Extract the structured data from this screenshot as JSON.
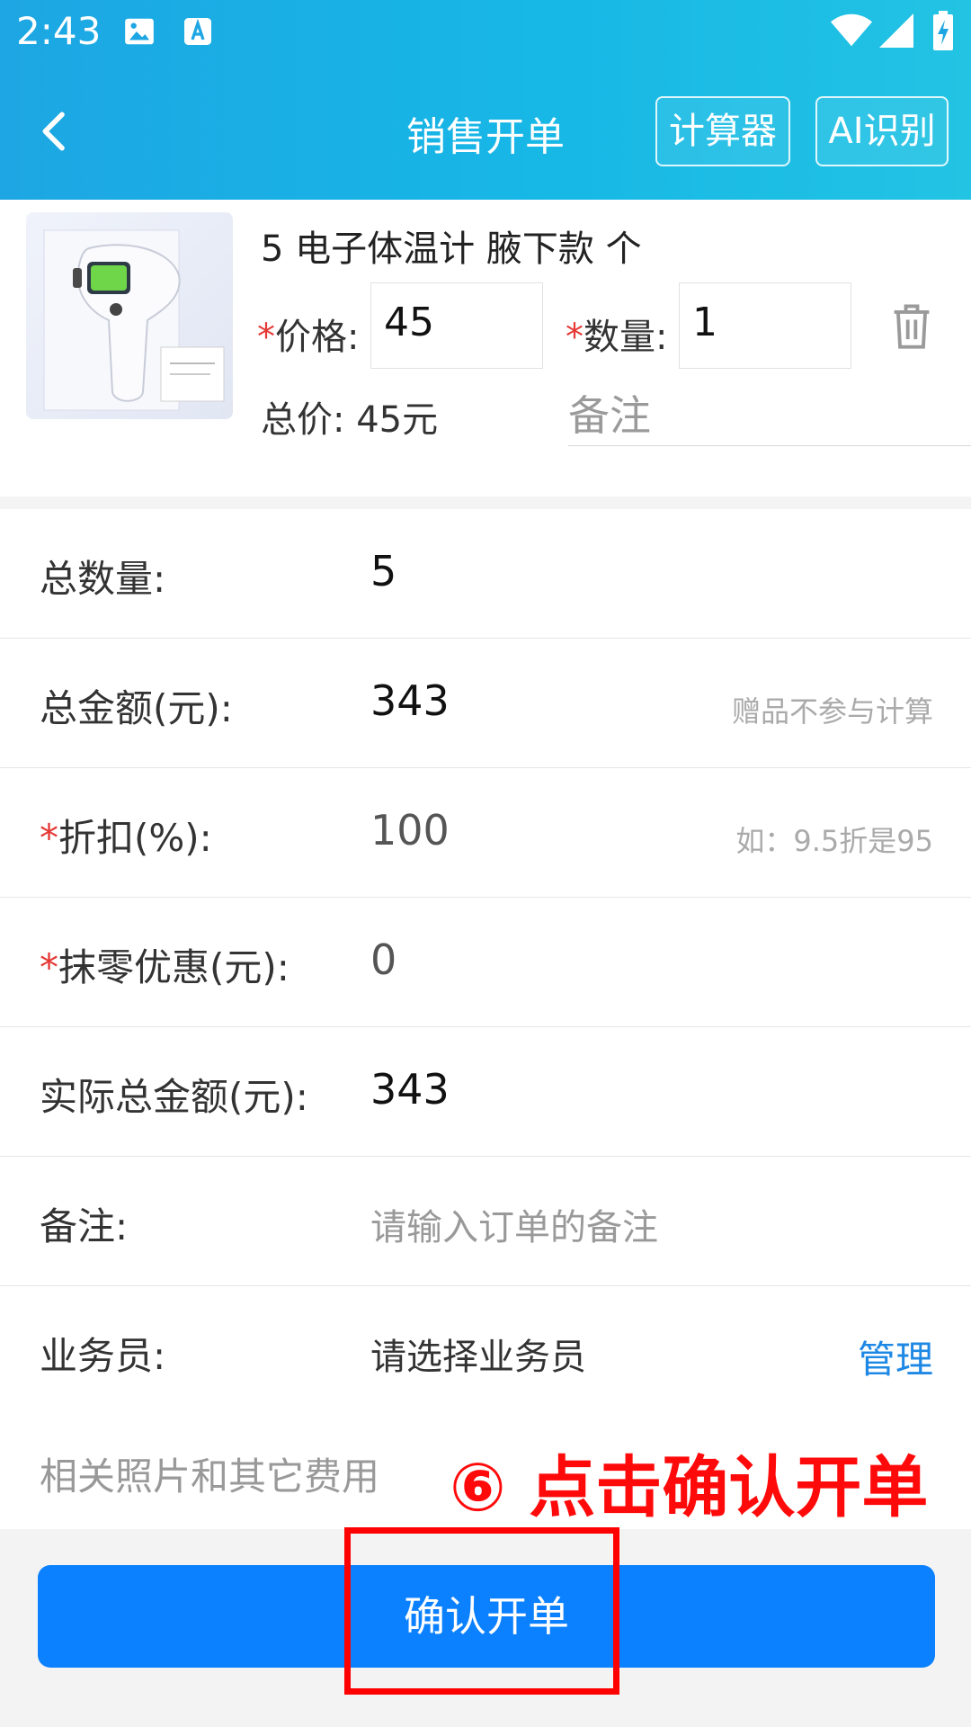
{
  "status_bar": {
    "time": "2:43"
  },
  "header": {
    "title": "销售开单",
    "calculator_label": "计算器",
    "ai_label": "AI识别"
  },
  "product": {
    "name": "5 电子体温计 腋下款 个",
    "price_label": "价格:",
    "price_value": "45",
    "qty_label": "数量:",
    "qty_value": "1",
    "total_label": "总价: 45元",
    "note_placeholder": "备注",
    "required_mark": "*"
  },
  "form": {
    "total_qty": {
      "label": "总数量:",
      "value": "5"
    },
    "total_amount": {
      "label": "总金额(元):",
      "value": "343",
      "hint": "赠品不参与计算"
    },
    "discount": {
      "label": "折扣(%):",
      "value": "100",
      "hint": "如：9.5折是95"
    },
    "rounding": {
      "label": "抹零优惠(元):",
      "value": "0"
    },
    "actual_total": {
      "label": "实际总金额(元):",
      "value": "343"
    },
    "remark": {
      "label": "备注:",
      "placeholder": "请输入订单的备注"
    },
    "salesperson": {
      "label": "业务员:",
      "placeholder": "请选择业务员",
      "manage_label": "管理"
    },
    "photos_label": "相关照片和其它费用"
  },
  "annotation": "⑥ 点击确认开单",
  "footer": {
    "confirm_label": "确认开单"
  },
  "colors": {
    "header_start": "#1da6e3",
    "header_end": "#22c3e3",
    "primary": "#0b81ff",
    "required": "#e53935",
    "annotation": "#ff0a0a"
  }
}
